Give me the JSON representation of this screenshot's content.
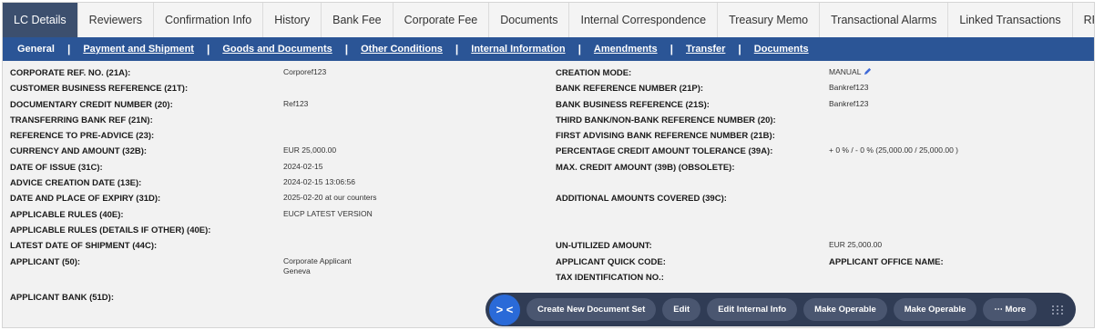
{
  "tabs": [
    "LC Details",
    "Reviewers",
    "Confirmation Info",
    "History",
    "Bank Fee",
    "Corporate Fee",
    "Documents",
    "Internal Correspondence",
    "Treasury Memo",
    "Transactional Alarms",
    "Linked Transactions",
    "RFQ"
  ],
  "subnav": [
    "General",
    "Payment and Shipment",
    "Goods and Documents",
    "Other Conditions",
    "Internal Information",
    "Amendments",
    "Transfer",
    "Documents"
  ],
  "left": {
    "corp_ref": {
      "label": "CORPORATE REF. NO. (21A):",
      "value": "Corporef123"
    },
    "customer_ref": {
      "label": "CUSTOMER BUSINESS REFERENCE (21T):"
    },
    "doc_credit": {
      "label": "DOCUMENTARY CREDIT NUMBER (20):",
      "value": "Ref123"
    },
    "transferring_ref": {
      "label": "TRANSFERRING BANK REF (21N):"
    },
    "pre_advice": {
      "label": "REFERENCE TO PRE-ADVICE (23):"
    },
    "currency": {
      "label": "CURRENCY AND AMOUNT (32B):",
      "value": "EUR  25,000.00"
    },
    "date_issue": {
      "label": "DATE OF ISSUE (31C):",
      "value": "2024-02-15"
    },
    "advice_date": {
      "label": "ADVICE CREATION DATE (13E):",
      "value": "2024-02-15 13:06:56"
    },
    "expiry": {
      "label": "DATE AND PLACE OF EXPIRY (31D):",
      "value": "2025-02-20  at our counters"
    },
    "rules": {
      "label": "APPLICABLE RULES (40E):",
      "value": "EUCP LATEST VERSION"
    },
    "rules_other": {
      "label": "APPLICABLE RULES (DETAILS IF OTHER) (40E):"
    },
    "shipment": {
      "label": "LATEST DATE OF SHIPMENT (44C):"
    },
    "applicant": {
      "label": "APPLICANT (50):",
      "value_line1": "Corporate Applicant",
      "value_line2": "Geneva"
    },
    "applicant_bank": {
      "label": "APPLICANT BANK (51D):"
    }
  },
  "right": {
    "creation_mode": {
      "label": "CREATION MODE:",
      "value": "MANUAL"
    },
    "bank_ref": {
      "label": "BANK REFERENCE NUMBER (21P):",
      "value": "Bankref123"
    },
    "bank_business_ref": {
      "label": "BANK BUSINESS REFERENCE (21S):",
      "value": "Bankref123"
    },
    "third_bank": {
      "label": "THIRD BANK/NON-BANK REFERENCE NUMBER (20):"
    },
    "first_advising": {
      "label": "FIRST ADVISING BANK REFERENCE NUMBER (21B):"
    },
    "tolerance": {
      "label": "PERCENTAGE CREDIT AMOUNT TOLERANCE (39A):",
      "value": "+ 0 % / - 0 % (25,000.00 / 25,000.00 )"
    },
    "max_credit": {
      "label": "MAX. CREDIT AMOUNT (39B) (OBSOLETE):"
    },
    "additional": {
      "label": "ADDITIONAL AMOUNTS COVERED (39C):"
    },
    "unutilized": {
      "label": "UN-UTILIZED AMOUNT:",
      "value": "EUR  25,000.00"
    },
    "quick_code": {
      "label": "APPLICANT QUICK CODE:"
    },
    "office_name": {
      "label": "APPLICANT OFFICE NAME:"
    },
    "tax_id": {
      "label": "TAX IDENTIFICATION NO.:"
    }
  },
  "actions": {
    "toggle_glyph": "> <",
    "buttons": [
      "Create New Document Set",
      "Edit",
      "Edit Internal Info",
      "Make Operable",
      "Make Operable"
    ],
    "more": "⋯  More"
  },
  "colors": {
    "tab_active": "#3c4f6e",
    "subnav": "#2b5596",
    "action_bar": "#303c55",
    "toggle": "#2a6ad8"
  },
  "icons": [
    "pencil-icon",
    "grip-icon"
  ]
}
